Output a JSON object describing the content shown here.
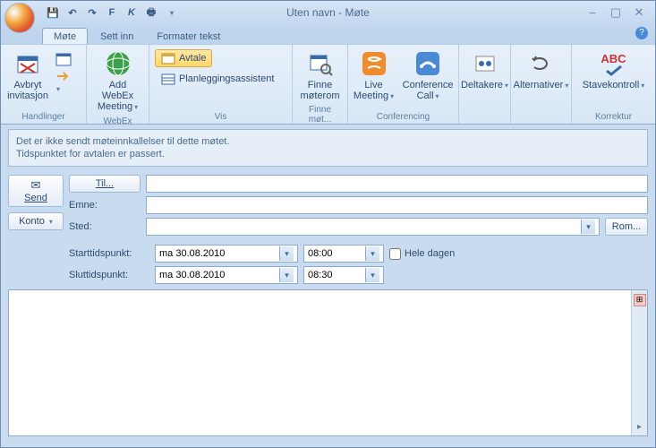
{
  "title": "Uten navn - Møte",
  "qat": {
    "save": "💾",
    "undo": "↶",
    "redo": "↷",
    "bold": "F",
    "italic": "K",
    "print": "🖶"
  },
  "tabs": {
    "mote": "Møte",
    "settinn": "Sett inn",
    "formater": "Formater tekst"
  },
  "ribbon": {
    "handlinger": {
      "label": "Handlinger",
      "avbryt": "Avbryt\ninvitasjon"
    },
    "webex": {
      "label": "WebEx",
      "add": "Add WebEx\nMeeting"
    },
    "vis": {
      "label": "Vis",
      "avtale": "Avtale",
      "planlegging": "Planleggingsassistent"
    },
    "finne": {
      "label": "Finne møt...",
      "btn": "Finne\nmøterom"
    },
    "conferencing": {
      "label": "Conferencing",
      "live": "Live\nMeeting",
      "conf": "Conference\nCall"
    },
    "deltakere": "Deltakere",
    "alternativer": "Alternativer",
    "korrektur": {
      "label": "Korrektur",
      "stave": "Stavekontroll"
    }
  },
  "info": {
    "line1": "Det er ikke sendt møteinnkallelser til dette møtet.",
    "line2": "Tidspunktet for avtalen er passert."
  },
  "form": {
    "send": "Send",
    "konto": "Konto",
    "til": "Til...",
    "emne": "Emne:",
    "sted": "Sted:",
    "rom": "Rom...",
    "start_label": "Starttidspunkt:",
    "slutt_label": "Sluttidspunkt:",
    "start_date": "ma 30.08.2010",
    "start_time": "08:00",
    "end_date": "ma 30.08.2010",
    "end_time": "08:30",
    "hele_dagen": "Hele dagen"
  }
}
